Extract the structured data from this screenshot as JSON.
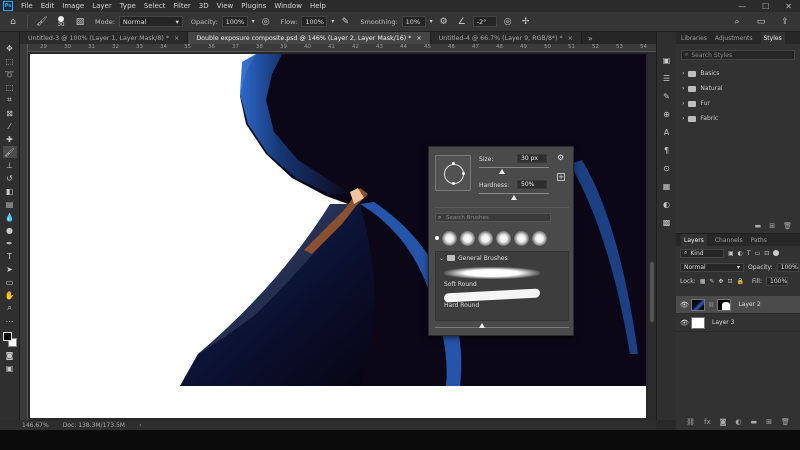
{
  "app": {
    "logo_text": "Ps"
  },
  "menu": [
    "File",
    "Edit",
    "Image",
    "Layer",
    "Type",
    "Select",
    "Filter",
    "3D",
    "View",
    "Plugins",
    "Window",
    "Help"
  ],
  "window_controls": {
    "minimize": "—",
    "maximize": "☐",
    "close": "✕"
  },
  "options_bar": {
    "brush_size": "30",
    "mode_label": "Mode:",
    "mode_value": "Normal",
    "opacity_label": "Opacity:",
    "opacity_value": "100%",
    "flow_label": "Flow:",
    "flow_value": "100%",
    "smoothing_label": "Smoothing:",
    "smoothing_value": "10%",
    "angle_value": "-2°"
  },
  "tabs": [
    {
      "label": "Untitled-3 @ 100% (Layer 1, Layer Mask/8) *",
      "close": "×"
    },
    {
      "label": "Double exposure composite.psd @ 146% (Layer 2, Layer Mask/16) *",
      "close": "×"
    },
    {
      "label": "Untitled-4 @ 66.7% (Layer 9, RGB/8*) *",
      "close": "×"
    }
  ],
  "ruler_ticks": [
    "29",
    "30",
    "31",
    "32",
    "33",
    "34",
    "35",
    "36",
    "37",
    "38",
    "39",
    "40",
    "41",
    "42",
    "43",
    "44",
    "45",
    "46",
    "47",
    "48",
    "49",
    "50",
    "51",
    "52",
    "53",
    "54"
  ],
  "status": {
    "zoom": "146.67%",
    "doc": "Doc: 138.3M/173.5M"
  },
  "brush_panel": {
    "size_label": "Size:",
    "size_value": "30 px",
    "hardness_label": "Hardness:",
    "hardness_value": "50%",
    "search_placeholder": "Search Brushes",
    "group_name": "General Brushes",
    "brushes": [
      "Soft Round",
      "Hard Round"
    ]
  },
  "right_panel": {
    "tabs": [
      "Libraries",
      "Adjustments",
      "Styles"
    ],
    "active_tab": "Styles",
    "search_placeholder": "Search Styles",
    "style_groups": [
      "Basics",
      "Natural",
      "Fur",
      "Fabric"
    ]
  },
  "layers_panel": {
    "tabs": [
      "Layers",
      "Channels",
      "Paths"
    ],
    "filter_value": "Kind",
    "blend_mode": "Normal",
    "opacity_label": "Opacity:",
    "opacity_value": "100%",
    "lock_label": "Lock:",
    "fill_label": "Fill:",
    "fill_value": "100%",
    "layers": [
      {
        "name": "Layer 2",
        "selected": true
      },
      {
        "name": "Layer 3",
        "selected": false
      }
    ]
  },
  "colors": {
    "accent": "#31a8ff",
    "canvas_dark": "#0c0716",
    "highlight_blue": "#2b69c9"
  }
}
